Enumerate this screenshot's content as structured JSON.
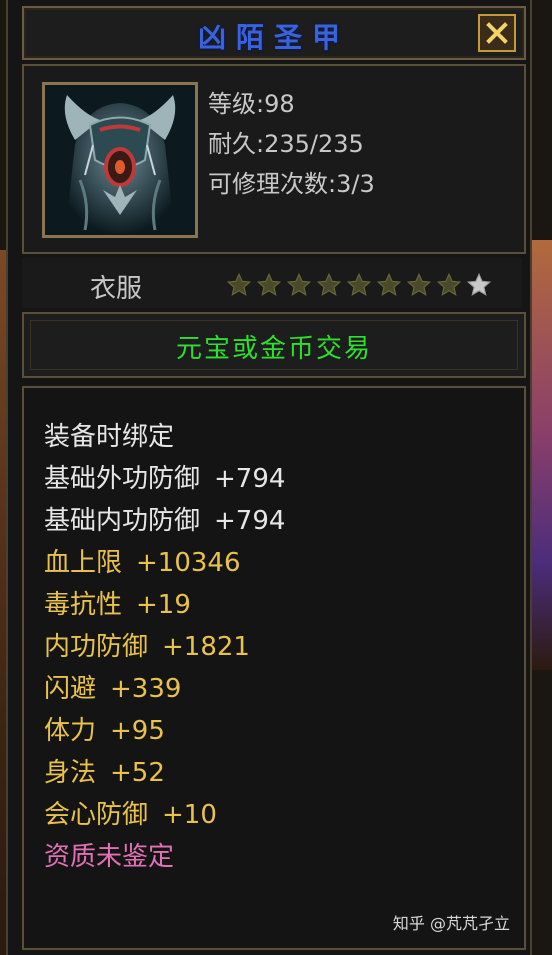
{
  "title": "凶陌圣甲",
  "item": {
    "stats": [
      {
        "label": "等级:",
        "value": "98"
      },
      {
        "label": "耐久:",
        "value": "235/235"
      },
      {
        "label": "可修理次数:",
        "value": "3/3"
      }
    ],
    "category": "衣服",
    "stars_filled": 8,
    "stars_total": 9,
    "trade": "元宝或金币交易"
  },
  "attributes": {
    "bind": "装备时绑定",
    "list": [
      {
        "name": "基础外功防御",
        "value": "+794",
        "color": "white"
      },
      {
        "name": "基础内功防御",
        "value": "+794",
        "color": "white"
      },
      {
        "name": "血上限",
        "value": "+10346",
        "color": "yellow"
      },
      {
        "name": "毒抗性",
        "value": "+19",
        "color": "yellow"
      },
      {
        "name": "内功防御",
        "value": "+1821",
        "color": "yellow"
      },
      {
        "name": "闪避",
        "value": "+339",
        "color": "yellow"
      },
      {
        "name": "体力",
        "value": "+95",
        "color": "yellow"
      },
      {
        "name": "身法",
        "value": "+52",
        "color": "yellow"
      },
      {
        "name": "会心防御",
        "value": "+10",
        "color": "yellow"
      }
    ],
    "quality": "资质未鉴定"
  },
  "watermark": "知乎 @芃芃孑立",
  "colors": {
    "title": "#3a63d8",
    "trade": "#2ee02e",
    "attr_white": "#e6e6e6",
    "attr_yellow": "#e8c24a",
    "quality": "#e071b4",
    "star_filled": "#4a4a2a",
    "star_empty": "#c9c9c9"
  },
  "icons": {
    "close": "close-icon",
    "star": "star-icon",
    "item": "armor-icon"
  }
}
